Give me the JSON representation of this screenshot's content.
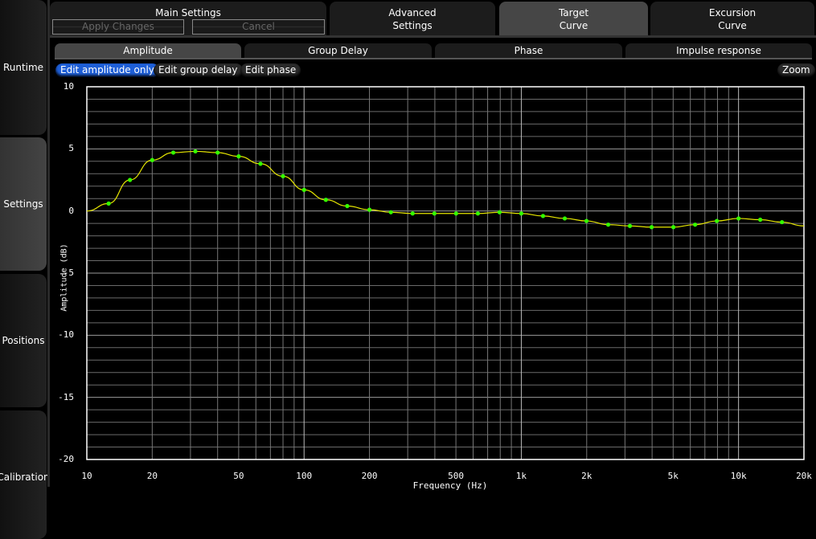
{
  "sidebar": {
    "items": [
      {
        "label": "Runtime"
      },
      {
        "label": "Settings"
      },
      {
        "label": "Positions"
      },
      {
        "label": "Calibration"
      }
    ]
  },
  "main_settings": {
    "title": "Main Settings",
    "apply": "Apply Changes",
    "cancel": "Cancel"
  },
  "tabs": [
    {
      "label": "Advanced\nSettings"
    },
    {
      "label": "Target\nCurve"
    },
    {
      "label": "Excursion\nCurve"
    }
  ],
  "subtabs": [
    {
      "label": "Amplitude"
    },
    {
      "label": "Group Delay"
    },
    {
      "label": "Phase"
    },
    {
      "label": "Impulse response"
    }
  ],
  "edit_buttons": [
    {
      "label": "Edit amplitude only"
    },
    {
      "label": "Edit group delay"
    },
    {
      "label": "Edit phase"
    }
  ],
  "zoom_label": "Zoom",
  "colors": {
    "accent": "#1e5fd8",
    "curve": "#e6e600",
    "points": "#33ff00"
  },
  "chart_data": {
    "type": "line",
    "xlabel": "Frequency (Hz)",
    "ylabel": "Amplitude (dB)",
    "xscale": "log",
    "xlim": [
      10,
      20000
    ],
    "ylim": [
      -20,
      10
    ],
    "yticks": [
      "10",
      "5",
      "0",
      "-5",
      "-10",
      "-15",
      "-20"
    ],
    "xticks": [
      {
        "v": 10,
        "l": "10"
      },
      {
        "v": 20,
        "l": "20"
      },
      {
        "v": 50,
        "l": "50"
      },
      {
        "v": 100,
        "l": "100"
      },
      {
        "v": 200,
        "l": "200"
      },
      {
        "v": 500,
        "l": "500"
      },
      {
        "v": 1000,
        "l": "1k"
      },
      {
        "v": 2000,
        "l": "2k"
      },
      {
        "v": 5000,
        "l": "5k"
      },
      {
        "v": 10000,
        "l": "10k"
      },
      {
        "v": 20000,
        "l": "20k"
      }
    ],
    "curve_x": [
      10,
      12.6,
      15.8,
      20,
      25,
      31.6,
      40,
      50,
      63,
      80,
      100,
      126,
      158,
      200,
      251,
      316,
      398,
      501,
      631,
      794,
      1000,
      1259,
      1585,
      1995,
      2512,
      3162,
      3981,
      5012,
      6310,
      7943,
      10000,
      12589,
      15849,
      20000
    ],
    "curve_y": [
      0,
      0.6,
      2.5,
      4.1,
      4.7,
      4.8,
      4.7,
      4.4,
      3.8,
      2.8,
      1.7,
      0.9,
      0.4,
      0.1,
      -0.1,
      -0.2,
      -0.2,
      -0.2,
      -0.2,
      -0.1,
      -0.2,
      -0.4,
      -0.6,
      -0.8,
      -1.1,
      -1.2,
      -1.3,
      -1.3,
      -1.1,
      -0.8,
      -0.6,
      -0.7,
      -0.9,
      -1.2
    ]
  }
}
